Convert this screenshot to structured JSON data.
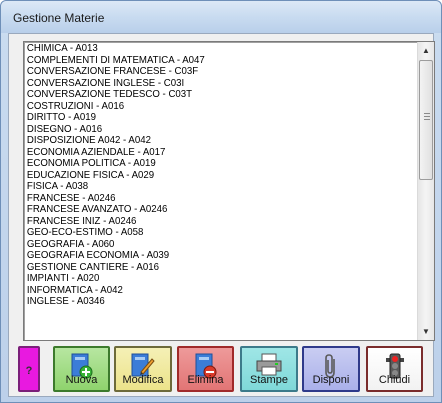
{
  "window": {
    "title": "Gestione Materie"
  },
  "materie": [
    "CHIMICA - A013",
    "COMPLEMENTI DI MATEMATICA - A047",
    "CONVERSAZIONE FRANCESE - C03F",
    "CONVERSAZIONE INGLESE - C03I",
    "CONVERSAZIONE TEDESCO - C03T",
    "COSTRUZIONI - A016",
    "DIRITTO - A019",
    "DISEGNO - A016",
    "DISPOSIZIONE A042 - A042",
    "ECONOMIA AZIENDALE - A017",
    "ECONOMIA POLITICA - A019",
    "EDUCAZIONE FISICA - A029",
    "FISICA - A038",
    "FRANCESE - A0246",
    "FRANCESE AVANZATO - A0246",
    "FRANCESE INIZ - A0246",
    "GEO-ECO-ESTIMO - A058",
    "GEOGRAFIA - A060",
    "GEOGRAFIA ECONOMIA - A039",
    "GESTIONE CANTIERE - A016",
    "IMPIANTI - A020",
    "INFORMATICA - A042",
    "INGLESE - A0346"
  ],
  "toolbar": {
    "help": "?",
    "nuova": "Nuova",
    "modifica": "Modifica",
    "elimina": "Elimina",
    "stampe": "Stampe",
    "disponi": "Disponi",
    "chiudi": "Chiudi"
  },
  "icons": {
    "nuova": "document-add-icon",
    "modifica": "document-edit-icon",
    "elimina": "document-delete-icon",
    "stampe": "printer-icon",
    "disponi": "paperclip-icon",
    "chiudi": "traffic-light-icon"
  }
}
